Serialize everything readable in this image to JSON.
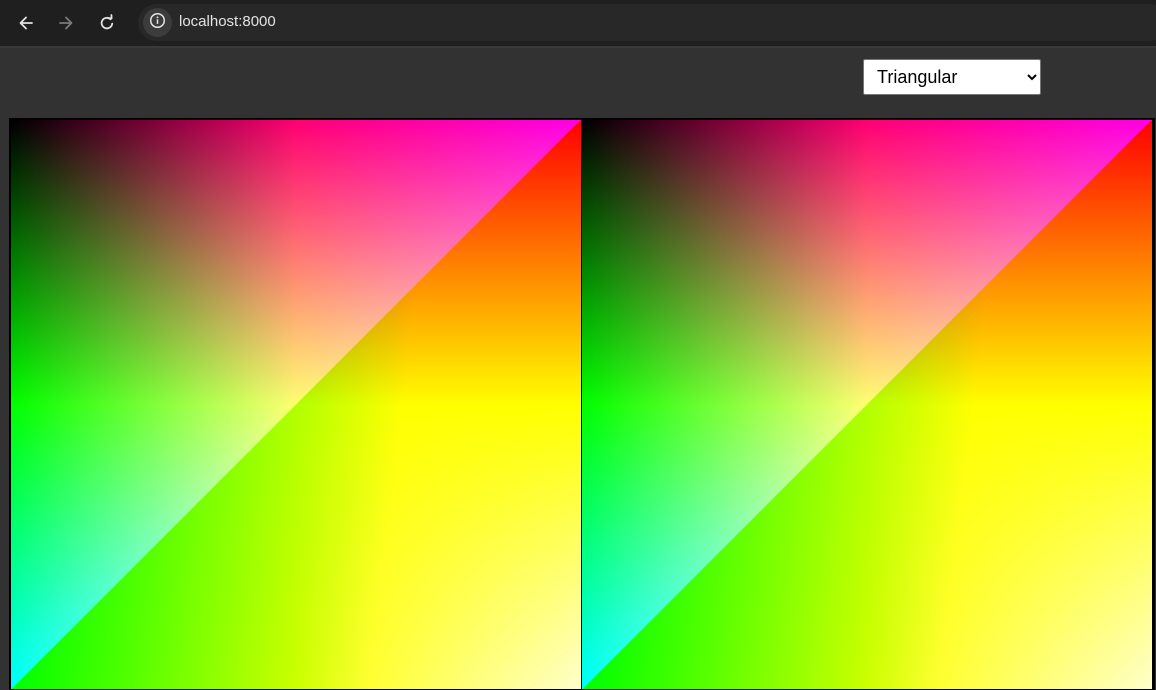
{
  "browser": {
    "url": "localhost:8000",
    "back_icon": "arrow-left-icon",
    "forward_icon": "arrow-right-icon",
    "reload_icon": "reload-icon",
    "site_info_icon": "info-icon"
  },
  "controls": {
    "mode_select": {
      "selected": "Triangular",
      "options": [
        "Triangular"
      ]
    }
  },
  "colors": {
    "page_background": "#323232",
    "toolbar_background": "#1f1f1f",
    "omnibox_background": "#282828"
  }
}
